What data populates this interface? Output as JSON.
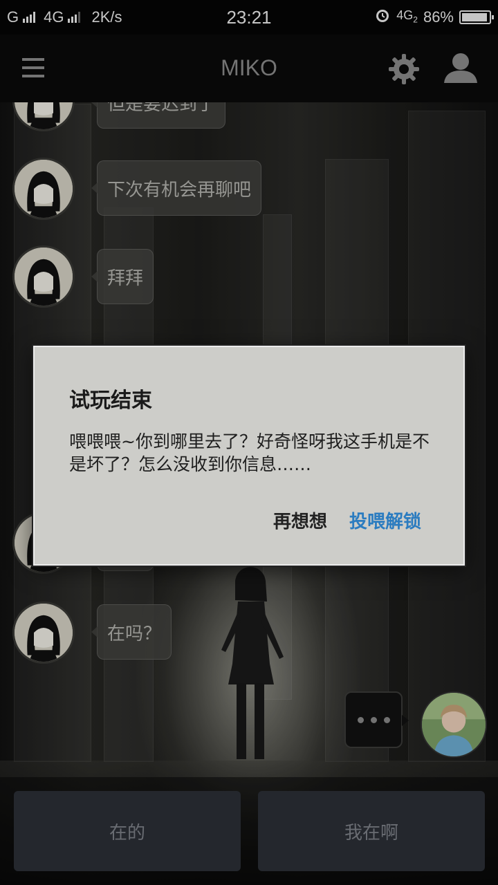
{
  "status_bar": {
    "carrier1": "G",
    "carrier2": "4G",
    "speed": "2K/s",
    "time": "23:21",
    "network": "4G",
    "network_sub": "2",
    "battery": "86%",
    "battery_level": 0.86
  },
  "header": {
    "title": "MIKO",
    "menu_icon": "menu-icon",
    "settings_icon": "gear-icon",
    "profile_icon": "user-icon"
  },
  "chat": {
    "messages": [
      {
        "text": "但是要迟到了"
      },
      {
        "text": "下次有机会再聊吧"
      },
      {
        "text": "拜拜"
      },
      {
        "text": "在吗？"
      }
    ],
    "typing_indicator": "..."
  },
  "dialog": {
    "title": "试玩结束",
    "message": "喂喂喂~你到哪里去了？好奇怪呀我这手机是不是坏了？怎么没收到你信息……",
    "cancel_label": "再想想",
    "confirm_label": "投喂解锁",
    "confirm_color": "#2b7cc0"
  },
  "replies": {
    "option1": "在的",
    "option2": "我在啊"
  }
}
